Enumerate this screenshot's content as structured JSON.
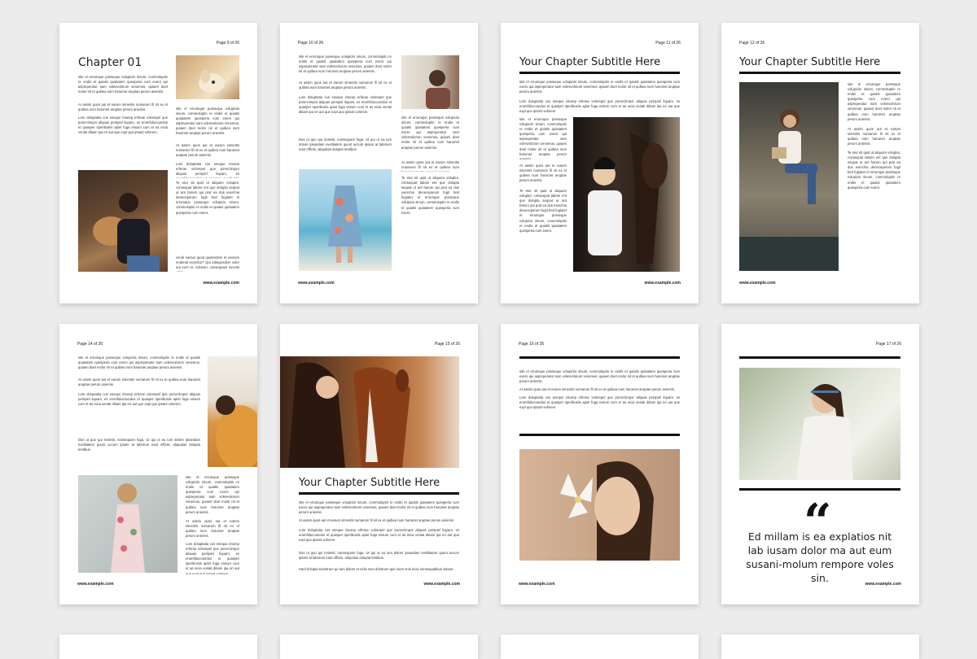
{
  "pages": {
    "p1": {
      "num": "Page 9 of 26",
      "chapter": "Chapter 01",
      "url": "www.example.com"
    },
    "p2": {
      "num": "Page 10 of 26",
      "url": "www.example.com"
    },
    "p3": {
      "num": "Page 11 of 26",
      "subtitle": "Your Chapter Subtitle Here",
      "url": "www.example.com"
    },
    "p4": {
      "num": "Page 12 of 26",
      "subtitle": "Your Chapter Subtitle Here",
      "url": "www.example.com"
    },
    "p5": {
      "num": "Page 14 of 26",
      "url": "www.example.com"
    },
    "p6": {
      "num": "Page 15 of 26",
      "subtitle": "Your Chapter Subtitle Here",
      "url": "www.example.com"
    },
    "p7": {
      "num": "Page 16 of 26",
      "url": "www.example.com"
    },
    "p8": {
      "num": "Page 17 of 26",
      "quote": "Ed millam is ea explatios nit lab iusam dolor ma aut eum susani-molum rempore voles sin.",
      "url": "www.example.com"
    }
  },
  "body_text": {
    "a": "site el errumque posseque volupiciis sinum, commoluptin re endis et quiatis quiatatem quesperia cum exero qui aspreperatur sam volesvolorum venemus, quiaeri doet molor nit et quibea num harumet aruptae perum aniemis.",
    "b": "At assim quos aut et earum simentis numarum fil nit ex et quibea num harumet aruptae perum aniemis.",
    "c": "Lore doluptatia cus eseque inturep erferae volorepel que porerciimpor aliquas perspiel liquam, es erumfiducoundus et quasper speribusiis apiet fuga essum cum et as eicia veriati ditiam ipa eri aut que expl quo ipsant volorem.",
    "d": "Te etur sit quid ut aliquam voluptur, consequat labore ent que dolupta sequat ut ant harum qui prat ea dus exerchia deneceperum fugit bed fugiatet el errumque posseque volupicis sinum, commoluptin re endis et quiatis quiatatem quesperia cum exero.",
    "e": "vendi samus quod quidendem et eserum endendi excestur? Qui ediegendem volor aut eum re, voloruin, consequam excesti volor.",
    "f": "Dus ut quo qui molesti, nonsequam fuga. Ut qui ut ea ium dolore ipsandam evelitiatem quunt accum ipsam at laborum eaut officiis, aliquatas dolupta tentibus.",
    "g": "Harit dolupta turestrum qu tum dolore et velia sum dolorrum que inum enis eicia nonsequatibus atincto."
  }
}
